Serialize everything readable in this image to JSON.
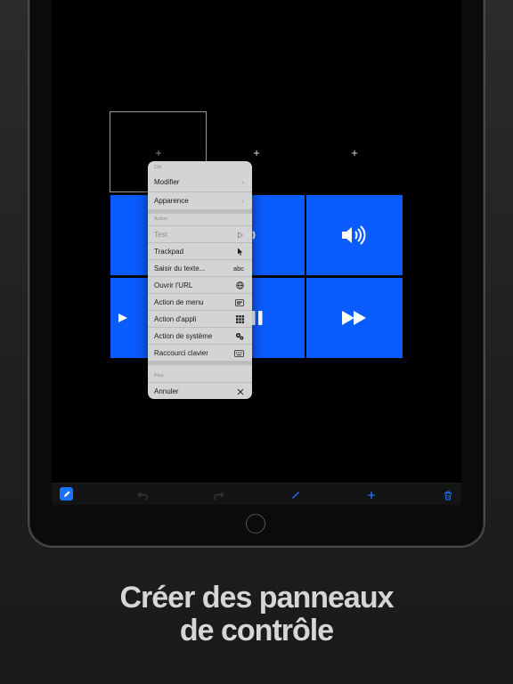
{
  "caption": {
    "line1": "Créer des panneaux",
    "line2": "de contrôle"
  },
  "canvas": {
    "add_slots": [
      "+",
      "+",
      "+"
    ],
    "tiles": [
      {
        "icon": "speaker-low-icon"
      },
      {
        "icon": "speaker-high-icon"
      },
      {
        "icon": "play-icon"
      },
      {
        "icon": "pause-icon"
      },
      {
        "icon": "fast-forward-icon"
      }
    ],
    "tile_color": "#0a5cff"
  },
  "menu": {
    "section_key": "Clé",
    "modify": "Modifier",
    "appearance": "Apparence",
    "section_action": "Action",
    "items": [
      {
        "label": "Test",
        "trail": "",
        "icon": "play-outline-icon"
      },
      {
        "label": "Trackpad",
        "trail": "",
        "icon": "cursor-icon"
      },
      {
        "label": "Saisir du texte...",
        "trail": "abc",
        "icon": ""
      },
      {
        "label": "Ouvrir l'URL",
        "trail": "",
        "icon": "globe-icon"
      },
      {
        "label": "Action de menu",
        "trail": "",
        "icon": "menu-bar-icon"
      },
      {
        "label": "Action d'appli",
        "trail": "",
        "icon": "app-grid-icon"
      },
      {
        "label": "Action de système",
        "trail": "",
        "icon": "gears-icon"
      },
      {
        "label": "Raccourci clavier",
        "trail": "",
        "icon": "keyboard-icon"
      }
    ],
    "section_more": "Plus",
    "cancel": "Annuler"
  },
  "toolbar": {
    "icons": [
      "pencil-icon",
      "undo-icon",
      "redo-icon",
      "draw-icon",
      "add-icon",
      "trash-icon"
    ],
    "accent": "#1a73ff"
  }
}
